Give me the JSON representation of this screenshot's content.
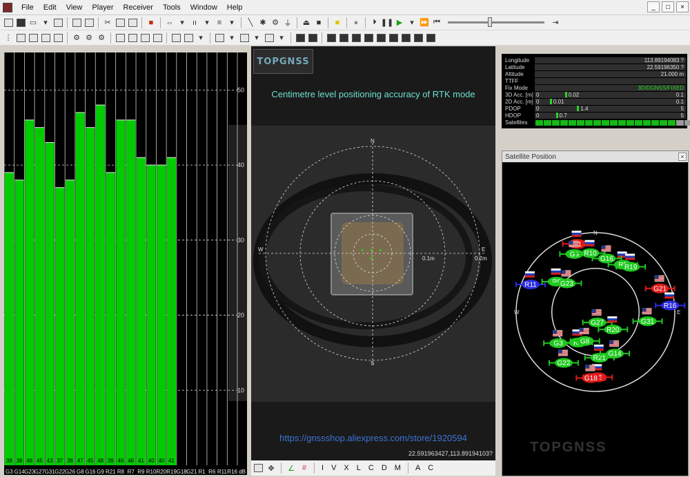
{
  "menu": [
    "File",
    "Edit",
    "View",
    "Player",
    "Receiver",
    "Tools",
    "Window",
    "Help"
  ],
  "window_controls": [
    "_",
    "□",
    "×"
  ],
  "signal_chart": {
    "y_ticks": [
      "50",
      "40",
      "30",
      "20",
      "10"
    ],
    "ylim": [
      0,
      55
    ],
    "x_unit": "dB",
    "bar_color": "#00cc00",
    "bars": [
      {
        "id": "G3",
        "value": 39
      },
      {
        "id": "G14",
        "value": 38
      },
      {
        "id": "G23",
        "value": 46
      },
      {
        "id": "G27",
        "value": 45
      },
      {
        "id": "G31",
        "value": 43
      },
      {
        "id": "G22",
        "value": 37
      },
      {
        "id": "G26",
        "value": 38
      },
      {
        "id": "G8",
        "value": 47
      },
      {
        "id": "G16",
        "value": 45
      },
      {
        "id": "G9",
        "value": 48
      },
      {
        "id": "R21",
        "value": 39
      },
      {
        "id": "R8",
        "value": 46
      },
      {
        "id": "R7",
        "value": 46
      },
      {
        "id": "R9",
        "value": 41
      },
      {
        "id": "R10",
        "value": 40
      },
      {
        "id": "R20",
        "value": 40
      },
      {
        "id": "R19",
        "value": 41
      },
      {
        "id": "G18",
        "value": null
      },
      {
        "id": "G21",
        "value": null
      },
      {
        "id": "R1",
        "value": null
      },
      {
        "id": "R6",
        "value": null
      },
      {
        "id": "R11",
        "value": null
      },
      {
        "id": "R16",
        "value": null
      }
    ]
  },
  "center": {
    "logo": "TOPGNSS",
    "headline": "Centimetre level positioning accuracy of RTK mode",
    "compass": {
      "n": "N",
      "s": "S",
      "e": "E",
      "w": "W"
    },
    "ring_labels": [
      "0.1m",
      "0.2m"
    ],
    "url": "https://gnssshop.aliexpress.com/store/1920594",
    "coords": "22.591963427,113.89194103?"
  },
  "bottom_bar": [
    "I",
    "V",
    "X",
    "L",
    "C",
    "D",
    "M",
    "A",
    "C"
  ],
  "info": {
    "longitude": {
      "label": "Longitude",
      "value": "113.89194083 ?"
    },
    "latitude": {
      "label": "Latitude",
      "value": "22.59196350 ?"
    },
    "altitude": {
      "label": "Altitude",
      "value": "21.000 m"
    },
    "ttff": {
      "label": "TTFF",
      "value": ""
    },
    "fixmode": {
      "label": "Fix Mode",
      "value": "3D/DGNSS/FIXED"
    },
    "acc3d": {
      "label": "3D Acc. [m]",
      "min": "0",
      "current": "0.02",
      "max": "0.1",
      "level": 0.2
    },
    "acc2d": {
      "label": "2D Acc. [m]",
      "min": "0",
      "current": "0.01",
      "max": "0.1",
      "level": 0.1
    },
    "pdop": {
      "label": "PDOP",
      "min": "0",
      "current": "1.4",
      "max": "5",
      "level": 0.28
    },
    "hdop": {
      "label": "HDOP",
      "min": "0",
      "current": "0.7",
      "max": "5",
      "level": 0.14
    },
    "satellites": {
      "label": "Satellites",
      "used": 17,
      "total": 20
    }
  },
  "satellite_window": {
    "title": "Satellite Position",
    "close": "×",
    "compass": {
      "n": "N",
      "e": "E",
      "w": "W"
    },
    "watermark": "TOPGNSS",
    "sats": [
      {
        "id": "R1",
        "sys": "RU",
        "az": -15,
        "el": 10,
        "color": "red"
      },
      {
        "id": "G9",
        "sys": "US",
        "az": -20,
        "el": 20,
        "color": "green"
      },
      {
        "id": "R10",
        "sys": "RU",
        "az": -5,
        "el": 23,
        "color": "green"
      },
      {
        "id": "R5",
        "sys": "RU",
        "az": 30,
        "el": 28,
        "color": "green"
      },
      {
        "id": "R19",
        "sys": "RU",
        "az": 38,
        "el": 25,
        "color": "green"
      },
      {
        "id": "G16",
        "sys": "US",
        "az": 12,
        "el": 28,
        "color": "green"
      },
      {
        "id": "R11",
        "sys": "RU",
        "az": -67,
        "el": 10,
        "color": "blue"
      },
      {
        "id": "G21",
        "sys": "US",
        "az": 70,
        "el": 12,
        "color": "red"
      },
      {
        "id": "R16",
        "sys": "RU",
        "az": 85,
        "el": 5,
        "color": "blue"
      },
      {
        "id": "R8",
        "sys": "RU",
        "az": -52,
        "el": 34,
        "color": "green"
      },
      {
        "id": "G23",
        "sys": "US",
        "az": -45,
        "el": 44,
        "color": "green"
      },
      {
        "id": "G31",
        "sys": "US",
        "az": 100,
        "el": 30,
        "color": "green"
      },
      {
        "id": "G27",
        "sys": "US",
        "az": 170,
        "el": 78,
        "color": "green"
      },
      {
        "id": "R20",
        "sys": "RU",
        "az": 135,
        "el": 62,
        "color": "green"
      },
      {
        "id": "G3",
        "sys": "US",
        "az": -130,
        "el": 35,
        "color": "green"
      },
      {
        "id": "R7",
        "sys": "RU",
        "az": -150,
        "el": 50,
        "color": "green"
      },
      {
        "id": "G8",
        "sys": "US",
        "az": -160,
        "el": 55,
        "color": "green"
      },
      {
        "id": "G22",
        "sys": "US",
        "az": -148,
        "el": 22,
        "color": "green"
      },
      {
        "id": "R21",
        "sys": "RU",
        "az": 175,
        "el": 38,
        "color": "green"
      },
      {
        "id": "G14",
        "sys": "US",
        "az": 155,
        "el": 38,
        "color": "green"
      },
      {
        "id": "R6",
        "sys": "RU",
        "az": 178,
        "el": 16,
        "color": "red"
      },
      {
        "id": "G18",
        "sys": "US",
        "az": -176,
        "el": 15,
        "color": "red"
      }
    ]
  }
}
